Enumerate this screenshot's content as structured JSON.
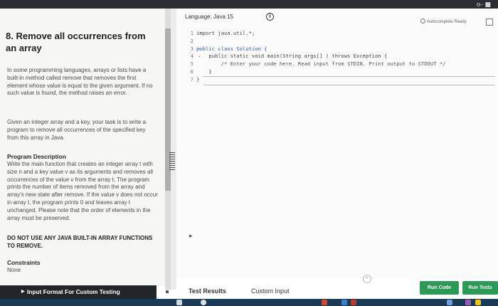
{
  "window": {
    "menu_dots": "o-  ■"
  },
  "problem": {
    "title": "8. Remove all occurrences from an array",
    "para1": "In some programming languages, arrays or lists have a built-in method called remove that removes the first element whose value is equal to the given argument. If no such value is found, the method raises an error.",
    "para2": "Given an integer array and a key, your task is to write a program to remove all occurrences of the specified key from this array in Java.",
    "desc_heading": "Program Description",
    "desc_body": "Write the main function that creates an integer array t with size n and a key value v as its arguments and removes all occurrences of the value v from the array t. The program prints the number of items removed from the array and array's new state after remove. If the value v does not occur in array t, the program prints 0 and leaves array t unchanged. Please note that the order of elements in the array must be preserved.",
    "desc_warning": "DO NOT USE ANY JAVA BUILT-IN ARRAY FUNCTIONS TO REMOVE.",
    "constraints_heading": "Constraints",
    "constraints_value": "None"
  },
  "editor": {
    "language_label": "Language: Java 15",
    "info_icon": "i",
    "autocomplete": "Autocomplete Ready",
    "line_numbers": [
      "1",
      "2",
      "3",
      "4",
      "5",
      "6",
      "7"
    ],
    "lines": [
      "import java.util.*;",
      "",
      "public class Solution {",
      "    public static void main(String args[] ) throws Exception {",
      "        /* Enter your code here. Read input from STDIN. Print output to STDOUT */",
      "    }",
      "}"
    ]
  },
  "bottom": {
    "input_format": "Input Format For Custom Testing",
    "tab_test_results": "Test Results",
    "tab_custom_input": "Custom Input",
    "run_code": "Run Code",
    "run_tests": "Run Tests"
  },
  "colors": {
    "accent": "#2a9a55",
    "dark": "#22262b",
    "keyword": "#3558b4"
  }
}
